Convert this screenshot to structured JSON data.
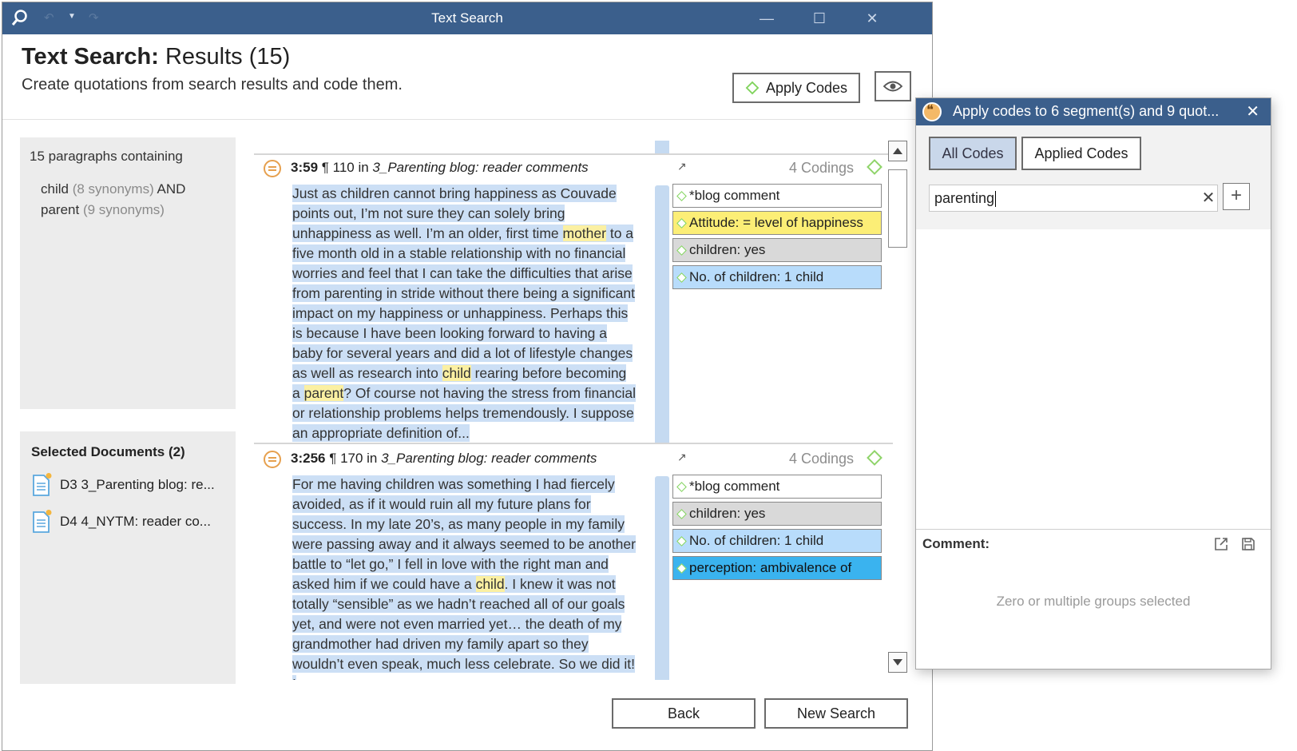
{
  "window": {
    "title": "Text Search"
  },
  "header": {
    "title_bold": "Text Search:",
    "title_rest": " Results (15)",
    "subtitle": "Create quotations from search results and code them.",
    "apply_codes_label": "Apply Codes"
  },
  "summary": {
    "line1": "15 paragraphs containing",
    "term1": "child",
    "term1_syn": "(8 synonyms)",
    "op": "AND",
    "term2": "parent",
    "term2_syn": "(9 synonyms)"
  },
  "selected_docs": {
    "header": "Selected Documents (2)",
    "items": [
      {
        "label": "D3 3_Parenting blog: re..."
      },
      {
        "label": "D4 4_NYTM: reader co..."
      }
    ]
  },
  "results": [
    {
      "id": "3:59",
      "para": "¶ 110 in",
      "doc": "3_Parenting blog: reader comments",
      "codings": "4 Codings",
      "text": [
        "Just as children cannot bring happiness as Couvade points out, I’m not sure they can solely bring unhappiness as well. I’m an older, first time ",
        "mother",
        " to a five month old in a stable relationship with no financial worries and feel that I can take the difficulties that arise from parenting in stride without there being a significant impact on my happiness or unhappiness. Perhaps this is because I have been looking forward to having a baby for several years and did a lot of lifestyle changes as well as research into ",
        "child",
        " rearing before becoming a ",
        "parent",
        "? Of course not having the stress from financial or relationship problems helps tremendously. I suppose an appropriate definition of..."
      ],
      "codes": [
        {
          "label": "*blog comment",
          "color": "#ffffff"
        },
        {
          "label": "Attitude: = level of happiness",
          "color": "#fcee76"
        },
        {
          "label": "children: yes",
          "color": "#d9d9d9"
        },
        {
          "label": "No. of children: 1 child",
          "color": "#b8dcfb"
        }
      ]
    },
    {
      "id": "3:256",
      "para": "¶ 170 in",
      "doc": "3_Parenting blog: reader comments",
      "codings": "4 Codings",
      "text": [
        "For me having children was something I had fiercely avoided, as if it would ruin all my future plans for success. In my late 20’s, as many people in my family were passing away and it always seemed to be another battle to “let go,” I fell in love with the right man and asked him if we could have a ",
        "child",
        ". I knew it was not totally “sensible” as we hadn’t reached all of our goals yet, and were not even married yet… the death of my grandmother had driven my family apart so they wouldn’t even speak, much less celebrate. So we did it! I"
      ],
      "codes": [
        {
          "label": "*blog comment",
          "color": "#ffffff"
        },
        {
          "label": "children: yes",
          "color": "#d9d9d9"
        },
        {
          "label": "No. of children: 1 child",
          "color": "#b8dcfb"
        },
        {
          "label": "perception: ambivalence of",
          "color": "#3ab3ef"
        }
      ]
    }
  ],
  "footer": {
    "back_label": "Back",
    "new_search_label": "New Search"
  },
  "dialog": {
    "title": "Apply codes to 6 segment(s) and 9 quot...",
    "tab_all": "All Codes",
    "tab_applied": "Applied Codes",
    "search_value": "parenting",
    "comment_label": "Comment:",
    "comment_placeholder": "Zero or multiple groups selected"
  },
  "colors": {
    "titlebar": "#3b5f8c",
    "highlight": "#ccdff5",
    "hit": "#fbf0a2"
  },
  "icons": [
    "app-search-icon",
    "undo-icon",
    "redo-icon",
    "minimize-icon",
    "maximize-icon",
    "close-icon",
    "eye-icon",
    "code-diamond-icon",
    "document-icon",
    "quotation-icon",
    "scroll-up-icon",
    "scroll-down-icon",
    "add-icon",
    "clear-icon",
    "external-link-icon",
    "save-icon"
  ]
}
